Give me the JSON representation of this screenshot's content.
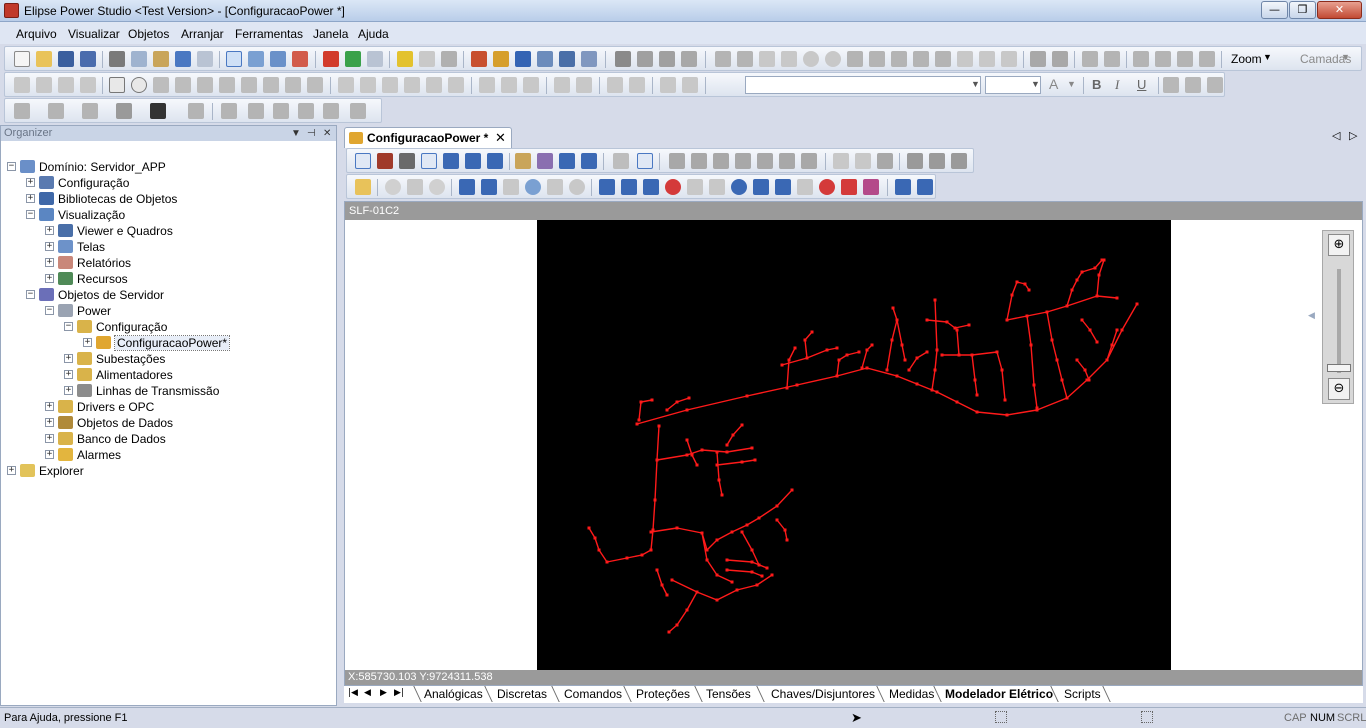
{
  "window": {
    "title": "Elipse Power Studio <Test Version> - [ConfiguracaoPower *]",
    "minimize": "—",
    "restore": "❐",
    "close": "✕"
  },
  "menu": [
    "Arquivo",
    "Visualizar",
    "Objetos",
    "Arranjar",
    "Ferramentas",
    "Janela",
    "Ajuda"
  ],
  "toolbar": {
    "zoom_label": "Zoom",
    "layers_label": "Camadas"
  },
  "organizer": {
    "title": "Organizer",
    "tree": [
      {
        "label": "Domínio: Servidor_APP",
        "level": 0,
        "expander": "−",
        "icon": "domain-icon",
        "color": "#6a8fc8"
      },
      {
        "label": "Configuração",
        "level": 1,
        "expander": "+",
        "icon": "config-icon",
        "color": "#5a7ab0"
      },
      {
        "label": "Bibliotecas de Objetos",
        "level": 1,
        "expander": "+",
        "icon": "library-icon",
        "color": "#3f68a8"
      },
      {
        "label": "Visualização",
        "level": 1,
        "expander": "−",
        "icon": "visualization-icon",
        "color": "#5b86c2"
      },
      {
        "label": "Viewer e Quadros",
        "level": 2,
        "expander": "+",
        "icon": "viewer-icon",
        "color": "#4a6fa8"
      },
      {
        "label": "Telas",
        "level": 2,
        "expander": "+",
        "icon": "screens-icon",
        "color": "#6d92c9"
      },
      {
        "label": "Relatórios",
        "level": 2,
        "expander": "+",
        "icon": "reports-icon",
        "color": "#c9877a"
      },
      {
        "label": "Recursos",
        "level": 2,
        "expander": "+",
        "icon": "resources-icon",
        "color": "#4f8a57"
      },
      {
        "label": "Objetos de Servidor",
        "level": 1,
        "expander": "−",
        "icon": "server-objects-icon",
        "color": "#6b6fb8"
      },
      {
        "label": "Power",
        "level": 2,
        "expander": "−",
        "icon": "power-icon",
        "color": "#9aa3b2"
      },
      {
        "label": "Configuração",
        "level": 3,
        "expander": "−",
        "icon": "power-config-icon",
        "color": "#d9b34a"
      },
      {
        "label": "ConfiguracaoPower*",
        "level": 4,
        "expander": "+",
        "icon": "power-config-object-icon",
        "color": "#e0a630",
        "selected": true
      },
      {
        "label": "Subestações",
        "level": 3,
        "expander": "+",
        "icon": "substations-icon",
        "color": "#d9b34a"
      },
      {
        "label": "Alimentadores",
        "level": 3,
        "expander": "+",
        "icon": "feeders-icon",
        "color": "#d9b34a"
      },
      {
        "label": "Linhas de Transmissão",
        "level": 3,
        "expander": "+",
        "icon": "transmission-lines-icon",
        "color": "#8c8c8c"
      },
      {
        "label": "Drivers e OPC",
        "level": 2,
        "expander": "+",
        "icon": "drivers-icon",
        "color": "#d9b34a"
      },
      {
        "label": "Objetos de Dados",
        "level": 2,
        "expander": "+",
        "icon": "data-objects-icon",
        "color": "#b08a3a"
      },
      {
        "label": "Banco de Dados",
        "level": 2,
        "expander": "+",
        "icon": "database-icon",
        "color": "#d9b34a"
      },
      {
        "label": "Alarmes",
        "level": 2,
        "expander": "+",
        "icon": "alarms-icon",
        "color": "#e3b53e"
      },
      {
        "label": "Explorer",
        "level": 0,
        "expander": "+",
        "icon": "explorer-icon",
        "color": "#e2c35a"
      }
    ]
  },
  "document": {
    "tab_label": "ConfiguracaoPower *",
    "tab_close": "✕",
    "canvas_name": "SLF-01C2",
    "coords": "X:585730.103 Y:9724311.538"
  },
  "sheet_tabs": [
    {
      "label": "Analógicas"
    },
    {
      "label": "Discretas"
    },
    {
      "label": "Comandos"
    },
    {
      "label": "Proteções"
    },
    {
      "label": "Tensões"
    },
    {
      "label": "Chaves/Disjuntores"
    },
    {
      "label": "Medidas"
    },
    {
      "label": "Modelador Elétrico",
      "active": true
    },
    {
      "label": "Scripts"
    }
  ],
  "status": {
    "message": "Para Ajuda, pressione F1",
    "caps": "CAP",
    "num": "NUM",
    "scroll": "SCRL"
  },
  "colors": {
    "network_line": "#ff1a1a",
    "canvas_bg": "#000000",
    "frame_gray": "#9a9a9a"
  }
}
